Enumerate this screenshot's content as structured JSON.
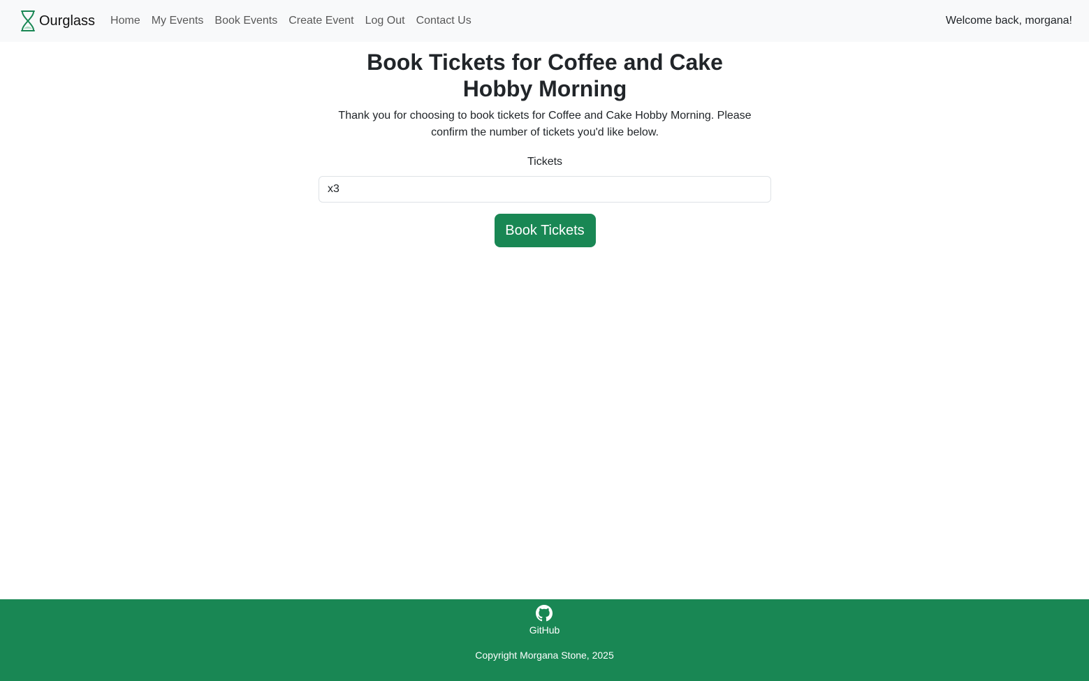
{
  "nav": {
    "brand": "Ourglass",
    "brand_icon": "hourglass-icon",
    "links": [
      "Home",
      "My Events",
      "Book Events",
      "Create Event",
      "Log Out",
      "Contact Us"
    ],
    "welcome": "Welcome back, morgana!"
  },
  "main": {
    "title": "Book Tickets for Coffee and Cake Hobby Morning",
    "intro": "Thank you for choosing to book tickets for Coffee and Cake Hobby Morning. Please confirm the number of tickets you'd like below.",
    "tickets_label": "Tickets",
    "tickets_value": "x3",
    "submit_label": "Book Tickets"
  },
  "footer": {
    "github_icon": "github-icon",
    "github_label": "GitHub",
    "copyright": "Copyright Morgana Stone, 2025"
  },
  "colors": {
    "accent": "#198754",
    "navbar_bg": "#f8f9fa"
  }
}
